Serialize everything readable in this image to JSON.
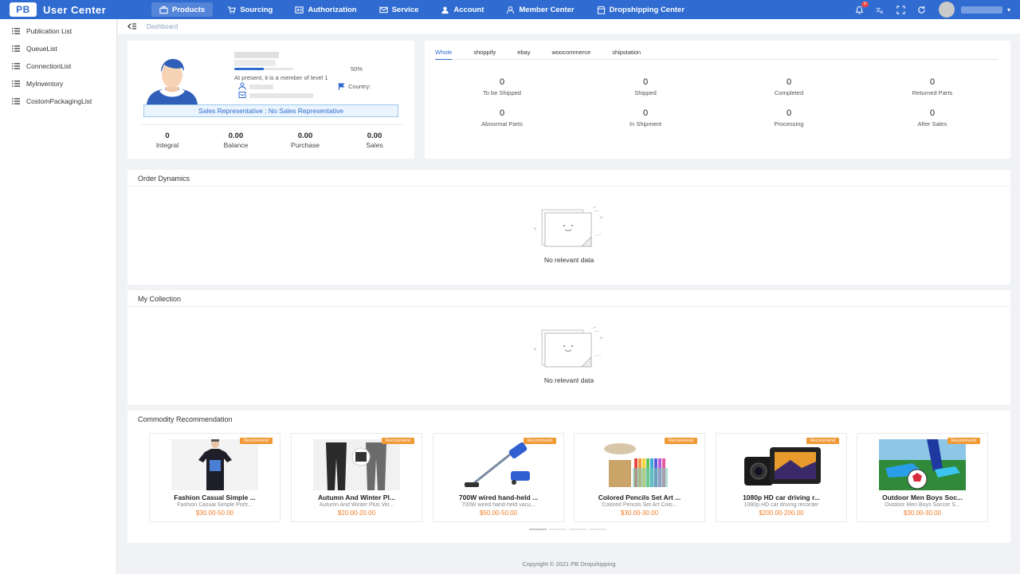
{
  "app": {
    "logo_mark": "PB",
    "title": "User Center"
  },
  "nav": [
    {
      "label": "Products",
      "icon": "briefcase-icon",
      "active": true
    },
    {
      "label": "Sourcing",
      "icon": "cart-icon"
    },
    {
      "label": "Authorization",
      "icon": "id-card-icon"
    },
    {
      "label": "Service",
      "icon": "mail-icon"
    },
    {
      "label": "Account",
      "icon": "user-icon"
    },
    {
      "label": "Member Center",
      "icon": "person-outline-icon"
    },
    {
      "label": "Dropshipping Center",
      "icon": "store-icon"
    }
  ],
  "top_right": {
    "notification_count": "0",
    "caret": "▾"
  },
  "sidebar": {
    "items": [
      {
        "label": "Publication List"
      },
      {
        "label": "QueueList"
      },
      {
        "label": "ConnectionList"
      },
      {
        "label": "MyInventory"
      },
      {
        "label": "CostomPackagingList"
      }
    ]
  },
  "breadcrumb": {
    "current": "Dashboard"
  },
  "profile": {
    "progress_percent": 50,
    "progress_label": "50%",
    "member_text": "At present, it is a member of level 1",
    "country_label": "Country:",
    "sales_rep": "Sales Representative : No Sales Representative",
    "stats": [
      {
        "value": "0",
        "label": "Integral"
      },
      {
        "value": "0.00",
        "label": "Balance"
      },
      {
        "value": "0.00",
        "label": "Purchase"
      },
      {
        "value": "0.00",
        "label": "Sales"
      }
    ]
  },
  "orders": {
    "tabs": [
      "Whole",
      "shoppify",
      "ebay",
      "woocommerce",
      "shipstation"
    ],
    "active_tab": "Whole",
    "statuses": [
      {
        "value": "0",
        "label": "To be Shipped"
      },
      {
        "value": "0",
        "label": "Shipped"
      },
      {
        "value": "0",
        "label": "Completed"
      },
      {
        "value": "0",
        "label": "Returned Parts"
      },
      {
        "value": "0",
        "label": "Abnormal Parts"
      },
      {
        "value": "0",
        "label": "In Shipment"
      },
      {
        "value": "0",
        "label": "Processing"
      },
      {
        "value": "0",
        "label": "After Sales"
      }
    ]
  },
  "order_dynamics": {
    "title": "Order Dynamics",
    "empty_text": "No relevant data"
  },
  "my_collection": {
    "title": "My Collection",
    "empty_text": "No relevant data"
  },
  "commodity": {
    "title": "Commodity Recommendation",
    "badge": "Recommend",
    "products": [
      {
        "title": "Fashion Casual Simple ...",
        "subtitle": "Fashion Casual Simple Portr...",
        "price": "$30.00-50.00",
        "image": "tshirt-image"
      },
      {
        "title": "Autumn And Winter Pl...",
        "subtitle": "Autumn And Winter Plus Vel...",
        "price": "$20.00-20.00",
        "image": "pants-image"
      },
      {
        "title": "700W wired hand-held ...",
        "subtitle": "700W wired hand-held vacu...",
        "price": "$50.00-50.00",
        "image": "vacuum-image"
      },
      {
        "title": "Colored Pencils Set Art ...",
        "subtitle": "Colored Pencils Set Art Colo...",
        "price": "$30.00-30.00",
        "image": "pencils-image"
      },
      {
        "title": "1080p HD car driving r...",
        "subtitle": "1080p HD car driving recorder",
        "price": "$200.00-200.00",
        "image": "dashcam-image"
      },
      {
        "title": "Outdoor Men Boys Soc...",
        "subtitle": "Outdoor Men Boys Soccer S...",
        "price": "$30.00-30.00",
        "image": "soccer-shoes-image"
      }
    ]
  },
  "footer": {
    "text": "Copyright © 2021 PB Dropshipping"
  },
  "colors": {
    "brand": "#2f6bd0",
    "price": "#f07a22",
    "badge": "#f09a36"
  }
}
